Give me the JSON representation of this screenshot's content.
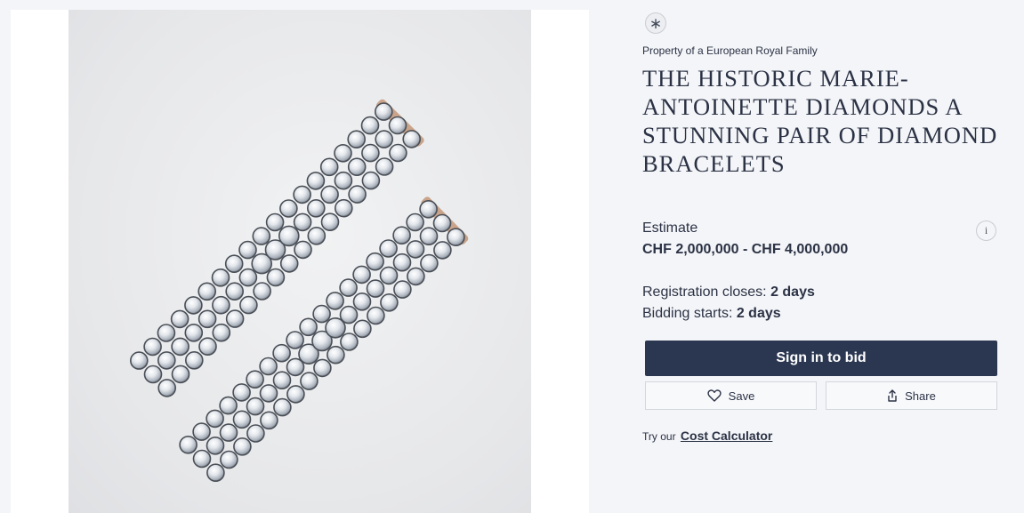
{
  "lot": {
    "badge_icon": "asterisk-icon",
    "badge_glyph": "∗",
    "provenance": "Property of a European Royal Family",
    "title": "THE HISTORIC MARIE-ANTOINETTE DIAMONDS A STUNNING PAIR OF DIAMOND BRACELETS"
  },
  "estimate": {
    "label": "Estimate",
    "value": "CHF 2,000,000 - CHF 4,000,000",
    "info_glyph": "i"
  },
  "timing": {
    "registration_label": "Registration closes: ",
    "registration_value": "2 days",
    "bidding_label": "Bidding starts: ",
    "bidding_value": "2 days"
  },
  "actions": {
    "sign_in_label": "Sign in to bid",
    "save_label": "Save",
    "share_label": "Share"
  },
  "calculator": {
    "prefix": "Try our",
    "link_label": "Cost Calculator"
  },
  "colors": {
    "page_bg": "#f4f5f8",
    "primary_button": "#2b3751",
    "text": "#2b3245"
  }
}
